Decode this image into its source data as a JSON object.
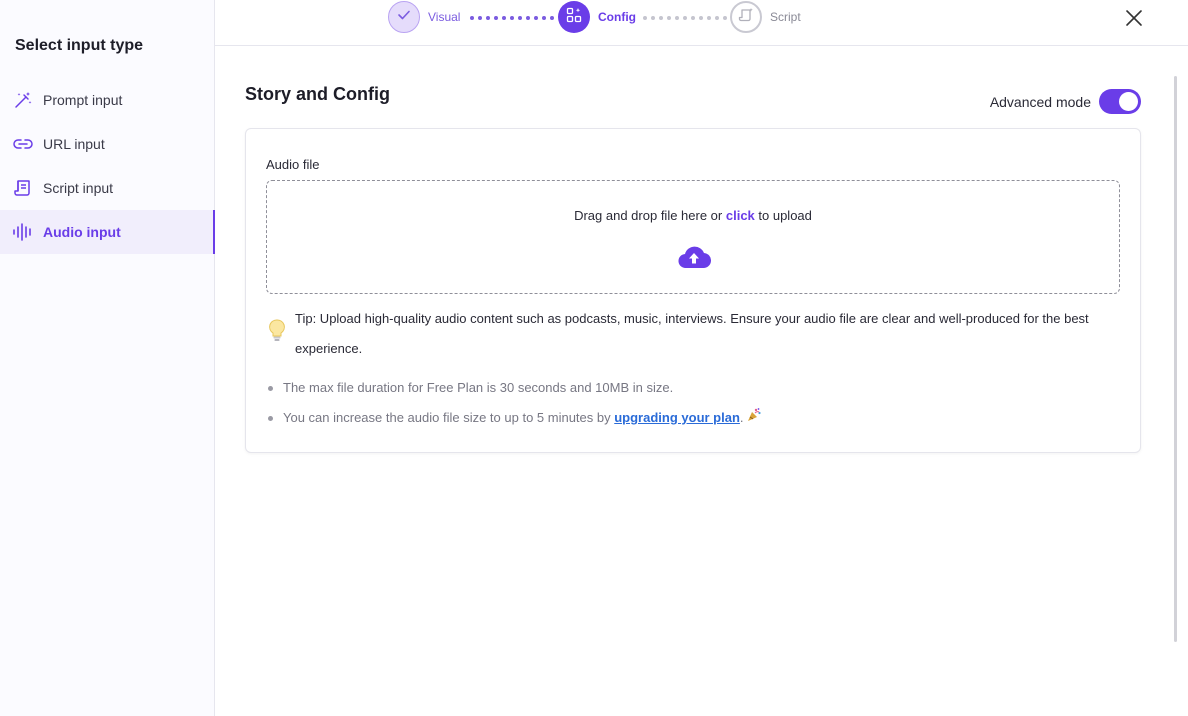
{
  "sidebar": {
    "title": "Select input type",
    "items": [
      {
        "label": "Prompt input",
        "icon": "magic-wand-icon"
      },
      {
        "label": "URL input",
        "icon": "link-icon"
      },
      {
        "label": "Script input",
        "icon": "script-icon"
      },
      {
        "label": "Audio input",
        "icon": "audio-wave-icon",
        "active": true
      }
    ]
  },
  "stepper": {
    "steps": [
      {
        "label": "Visual",
        "state": "completed",
        "icon": "check-icon"
      },
      {
        "label": "Config",
        "state": "current",
        "icon": "config-icon"
      },
      {
        "label": "Script",
        "state": "pending",
        "icon": "script-icon"
      }
    ]
  },
  "main": {
    "title": "Story and Config",
    "advanced_mode": {
      "label": "Advanced mode",
      "enabled": true
    },
    "audio": {
      "label": "Audio file",
      "dropzone_text_before": "Drag and drop file here or ",
      "dropzone_link": "click",
      "dropzone_text_after": " to upload",
      "upload_icon": "cloud-upload-icon"
    },
    "tip": "Tip: Upload high-quality audio content such as podcasts, music, interviews. Ensure your audio file are clear and well-produced for the best experience.",
    "notes": {
      "note1": "The max file duration for Free Plan is 30 seconds and 10MB in size.",
      "note2_before": "You can increase the audio file size to up to 5 minutes by ",
      "note2_link": "upgrading your plan",
      "note2_after": "."
    }
  },
  "colors": {
    "accent": "#6a3de8",
    "link": "#2a6bd8",
    "active_bg": "#f1eefc"
  }
}
